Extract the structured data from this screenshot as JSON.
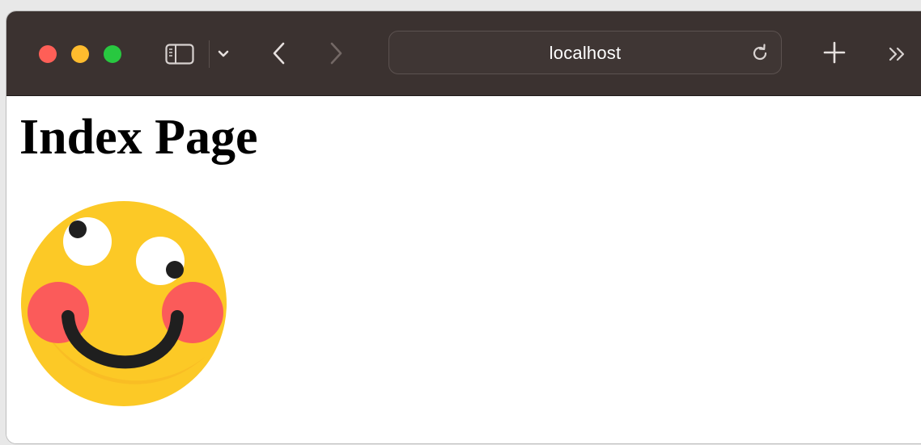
{
  "browser": {
    "address": "localhost",
    "colors": {
      "toolbar": "#3b3230",
      "close": "#fe5f57",
      "minimize": "#febc2e",
      "maximize": "#28c840"
    },
    "icons": {
      "sidebar": "sidebar-icon",
      "tab_group_menu": "chevron-down-icon",
      "back": "chevron-left-icon",
      "forward": "chevron-right-icon",
      "reload": "reload-icon",
      "new_tab": "plus-icon",
      "overflow": "double-chevron-right-icon"
    }
  },
  "page": {
    "title": "Index Page",
    "image": {
      "icon": "smiley-face-emoji",
      "colors": {
        "face": "#fcc926",
        "cheeks": "#fb5b5a",
        "features": "#1f1f1f"
      }
    }
  }
}
